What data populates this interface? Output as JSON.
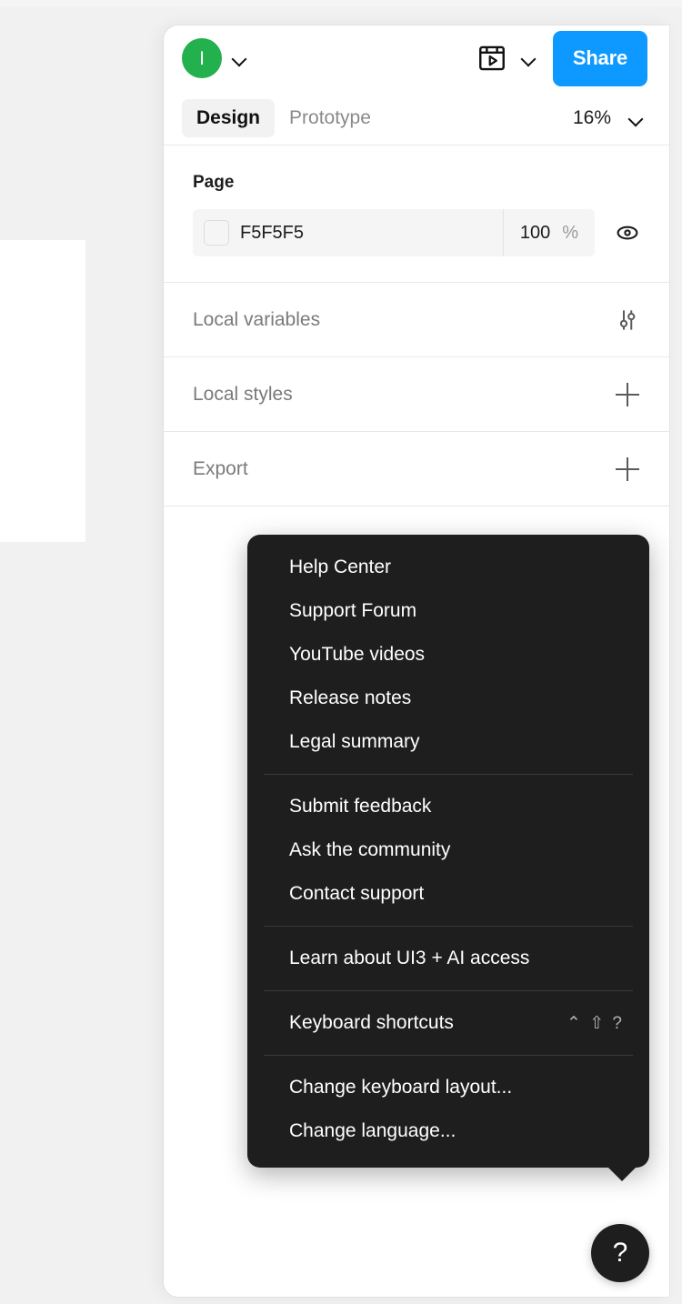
{
  "toolbar": {
    "avatar_initial": "I",
    "avatar_chevron_icon": "chevron-down-icon",
    "present_icon": "present-play-icon",
    "present_chevron_icon": "chevron-down-icon",
    "share_label": "Share",
    "share_color": "#0d99ff",
    "avatar_color": "#22b14c"
  },
  "tabs": {
    "design_label": "Design",
    "prototype_label": "Prototype",
    "zoom_level": "16%",
    "zoom_chevron_icon": "chevron-down-icon"
  },
  "page_section": {
    "title": "Page",
    "fill_hex": "F5F5F5",
    "opacity_value": "100",
    "opacity_unit": "%",
    "visibility_icon": "eye-icon"
  },
  "rows": [
    {
      "label": "Local variables",
      "action_icon": "sliders-icon"
    },
    {
      "label": "Local styles",
      "action_icon": "plus-icon"
    },
    {
      "label": "Export",
      "action_icon": "plus-icon"
    }
  ],
  "help_menu": {
    "groups": [
      {
        "items": [
          {
            "label": "Help Center",
            "shortcut": ""
          },
          {
            "label": "Support Forum",
            "shortcut": ""
          },
          {
            "label": "YouTube videos",
            "shortcut": ""
          },
          {
            "label": "Release notes",
            "shortcut": ""
          },
          {
            "label": "Legal summary",
            "shortcut": ""
          }
        ]
      },
      {
        "items": [
          {
            "label": "Submit feedback",
            "shortcut": ""
          },
          {
            "label": "Ask the community",
            "shortcut": ""
          },
          {
            "label": "Contact support",
            "shortcut": ""
          }
        ]
      },
      {
        "items": [
          {
            "label": "Learn about UI3 + AI access",
            "shortcut": ""
          }
        ]
      },
      {
        "items": [
          {
            "label": "Keyboard shortcuts",
            "shortcut": "⌃ ⇧ ?"
          }
        ]
      },
      {
        "items": [
          {
            "label": "Change keyboard layout...",
            "shortcut": ""
          },
          {
            "label": "Change language...",
            "shortcut": ""
          }
        ]
      }
    ]
  },
  "help_fab": {
    "label": "?",
    "icon": "question-mark-icon"
  }
}
